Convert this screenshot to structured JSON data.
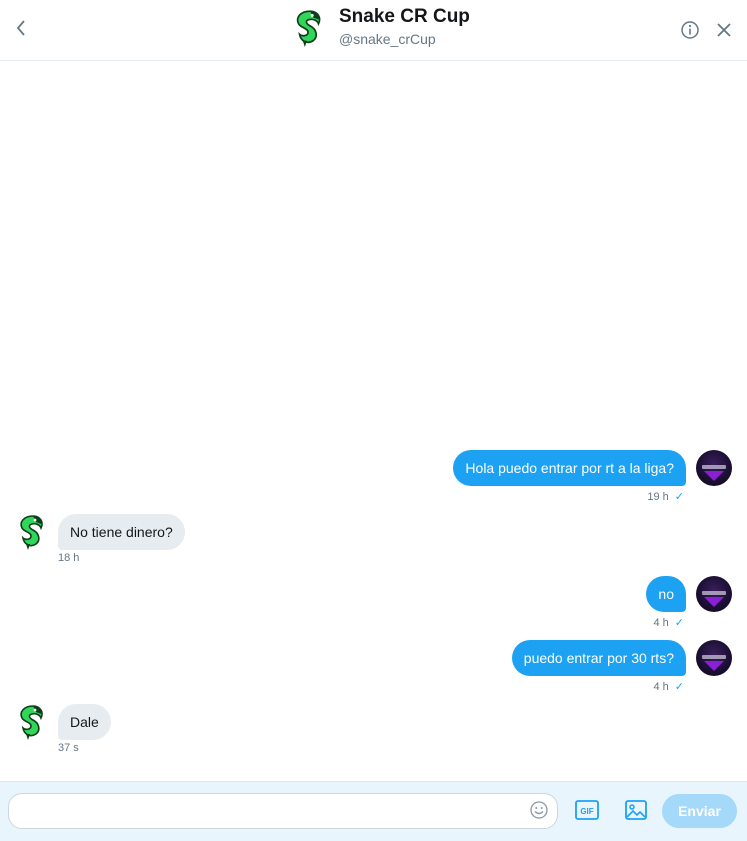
{
  "header": {
    "name": "Snake CR Cup",
    "handle": "@snake_crCup",
    "icons": {
      "back": "chevron-left-icon",
      "info": "info-circle-icon",
      "close": "close-icon"
    }
  },
  "messages": [
    {
      "direction": "outgoing",
      "text": "Hola puedo entrar por rt a la liga?",
      "time": "19 h",
      "status": "✓"
    },
    {
      "direction": "incoming",
      "text": "No tiene dinero?",
      "time": "18 h"
    },
    {
      "direction": "outgoing",
      "text": "no",
      "time": "4 h",
      "status": "✓"
    },
    {
      "direction": "outgoing",
      "text": "puedo entrar por 30  rts?",
      "time": "4 h",
      "status": "✓"
    },
    {
      "direction": "incoming",
      "text": "Dale",
      "time": "37 s"
    }
  ],
  "composer": {
    "input_value": "",
    "input_placeholder": "",
    "send_label": "Enviar",
    "gif_label": "GIF",
    "icons": {
      "emoji": "smiley-icon",
      "gif": "gif-icon",
      "media": "image-icon"
    }
  },
  "colors": {
    "accent": "#1da1f2",
    "incoming_bubble": "#e6ecf0",
    "composer_bg": "#e8f5fd",
    "send_disabled": "#a4d9f9",
    "snake_green": "#2fd65a"
  }
}
